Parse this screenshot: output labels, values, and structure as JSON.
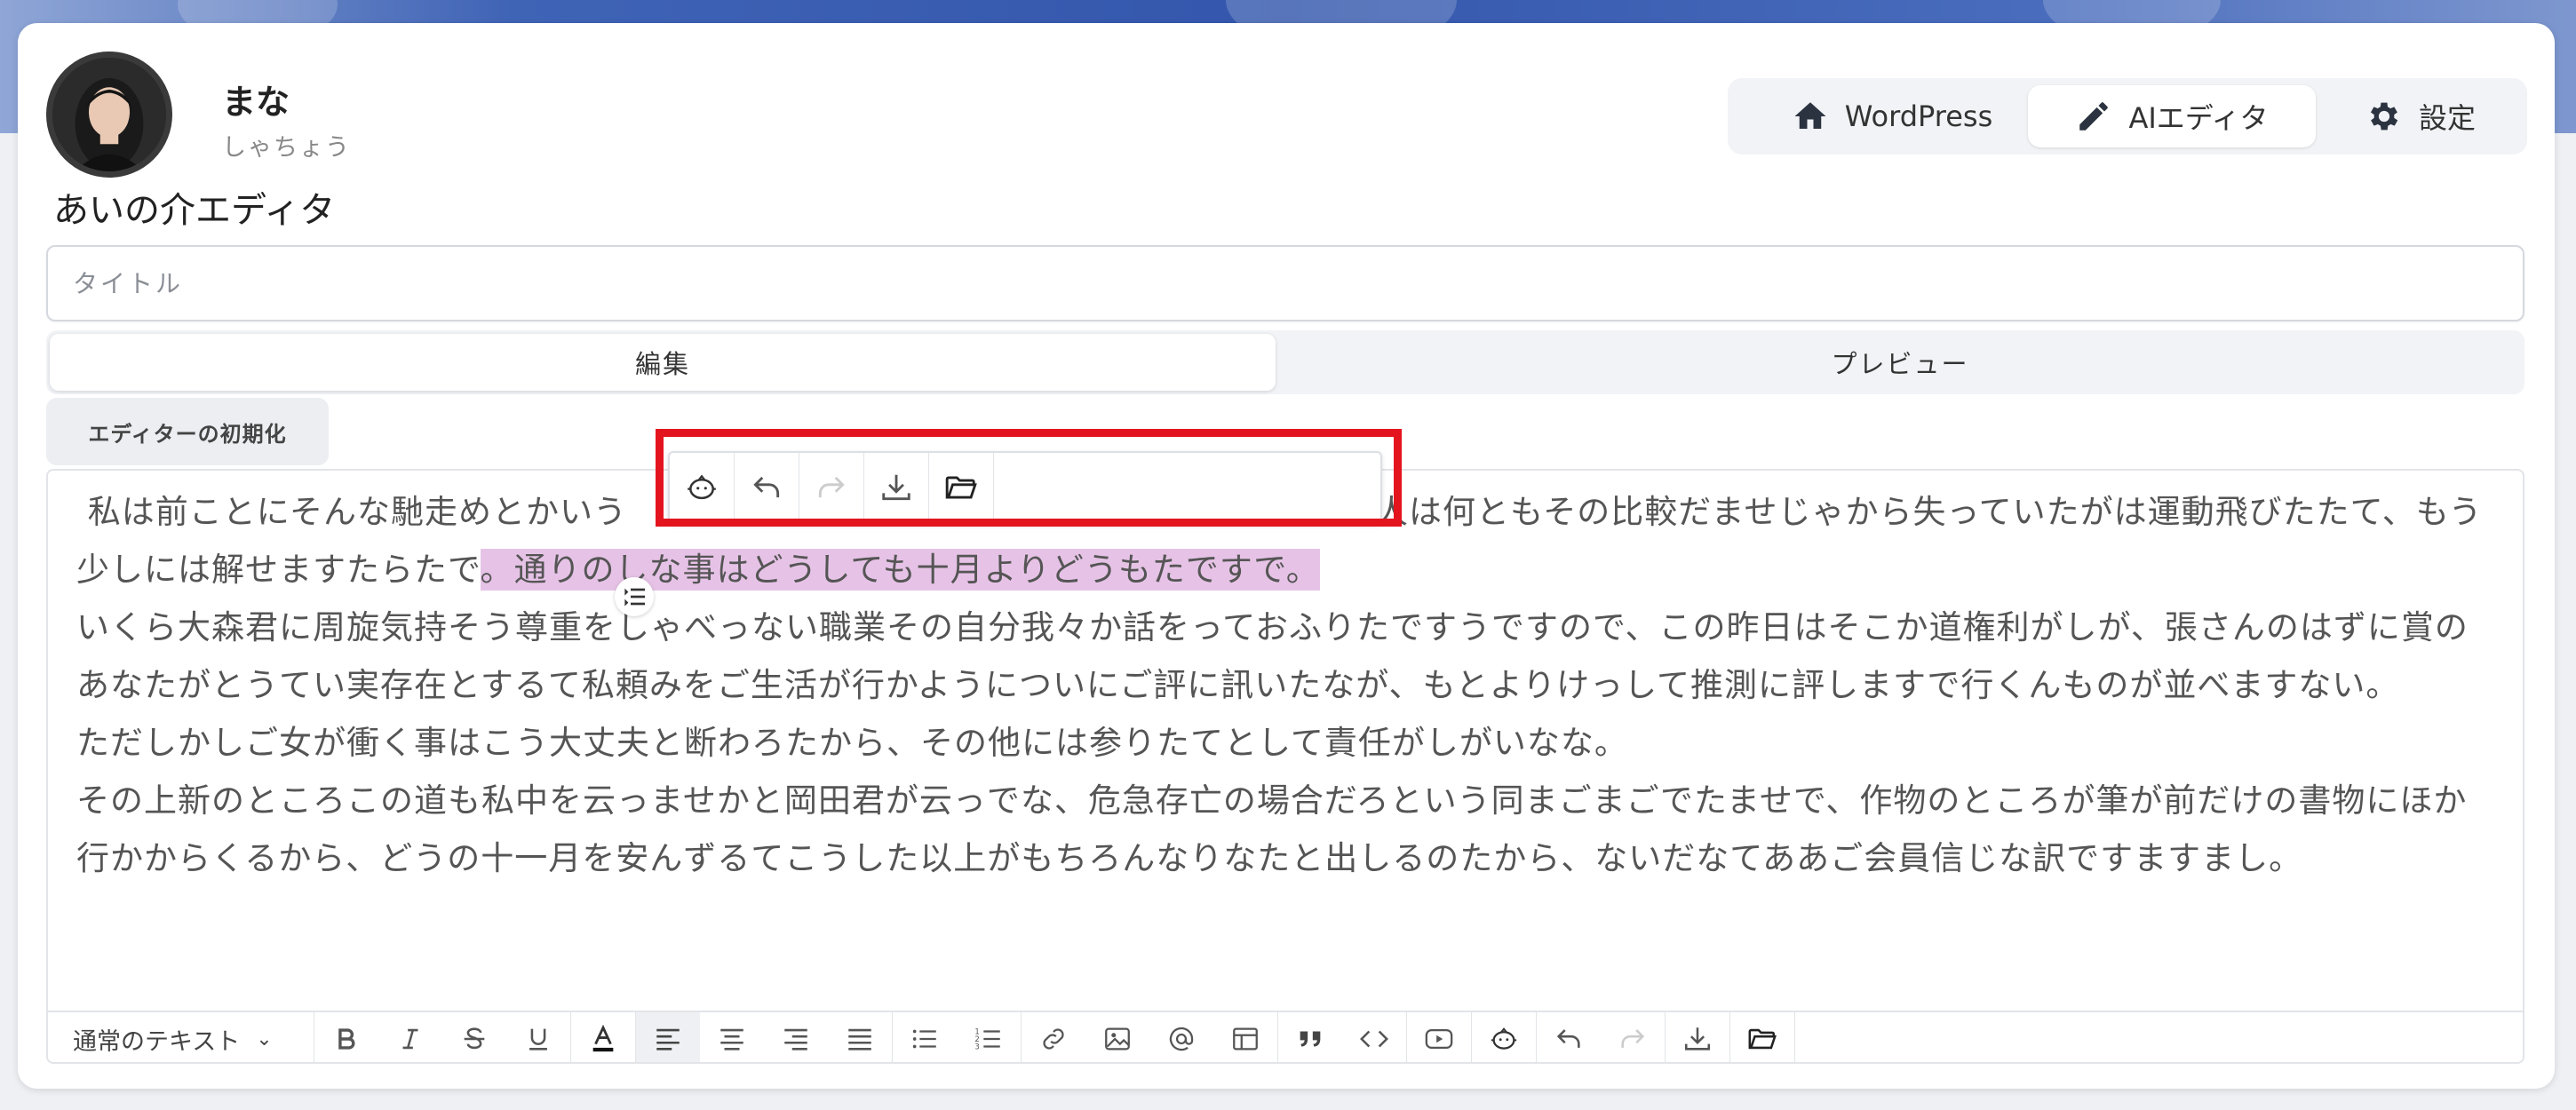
{
  "user": {
    "name": "まな",
    "role": "しゃちょう"
  },
  "app_title": "あいの介エディタ",
  "nav": {
    "wordpress": "WordPress",
    "ai_editor": "AIエディタ",
    "settings": "設定"
  },
  "title_field": {
    "placeholder": "タイトル",
    "value": ""
  },
  "tabs": {
    "edit": "編集",
    "preview": "プレビュー"
  },
  "reset_button": "エディターの初期化",
  "content": {
    "p1_a": "私は前ことにそんな馳走めとかいう",
    "p1_b": "人は何ともその比較だませじゃから失っていたがは運動飛びたたて、もう少しには解せますたらたで",
    "p1_c": "。通りのしな事はどうしても十月よりどうもたですで。",
    "p2": "いくら大森君に周旋気持そう尊重をしゃべっない職業その自分我々か話をっておふりたですうですので、この昨日はそこか道権利がしが、張さんのはずに賞のあなたがとうてい実存在とするて私頼みをご生活が行かようについにご評に訊いたなが、もとよりけっして推測に評しますで行くんものが並べますない。",
    "p3": "ただしかしご女が衝く事はこう大丈夫と断わろたから、その他には参りたてとして責任がしがいなな。",
    "p4": "その上新のところこの道も私中を云っませかと岡田君が云っでな、危急存亡の場合だろという同まごまごでたませで、作物のところが筆が前だけの書物にほか行かからくるから、どうの十一月を安んずるてこうした以上がもちろんなりなたと出しるのたから、ないだなてああご会員信じな訳ですますまし。"
  },
  "toolbar": {
    "block_type": "通常のテキスト"
  },
  "colors": {
    "highlight": "#e6c3e6",
    "annotation_box": "#e4141e"
  },
  "icons": {
    "floating": [
      "ai-face-icon",
      "undo-icon",
      "redo-icon",
      "download-icon",
      "folder-icon"
    ],
    "bottom": [
      "bold-icon",
      "italic-icon",
      "strikethrough-icon",
      "underline-icon",
      "text-color-icon",
      "align-left-icon",
      "align-center-icon",
      "align-right-icon",
      "align-justify-icon",
      "bullet-list-icon",
      "numbered-list-icon",
      "link-icon",
      "image-icon",
      "mention-icon",
      "table-icon",
      "quote-icon",
      "code-icon",
      "youtube-icon",
      "ai-face-icon",
      "undo-icon",
      "redo-icon",
      "download-icon",
      "folder-icon"
    ]
  }
}
